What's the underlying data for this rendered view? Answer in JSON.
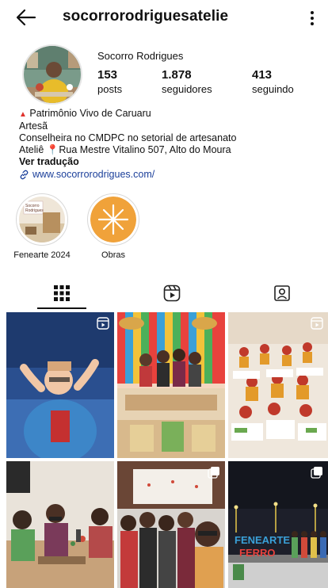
{
  "header": {
    "username": "socorrorodriguesatelie",
    "back_icon": "back-arrow-icon",
    "menu_icon": "more-vertical-icon"
  },
  "profile": {
    "display_name": "Socorro Rodrigues",
    "stats": [
      {
        "value": "153",
        "label": "posts"
      },
      {
        "value": "1.878",
        "label": "seguidores"
      },
      {
        "value": "413",
        "label": "seguindo"
      }
    ]
  },
  "bio": {
    "line1": "Patrimônio Vivo de Caruaru",
    "line2": "Artesã",
    "line3": "Conselheira no CMDPC no setorial de artesanato",
    "line4_prefix": "Ateliê",
    "line4_suffix": "Rua Mestre Vitalino 507, Alto do Moura",
    "translate": "Ver tradução",
    "link": "www.socorrorodrigues.com/"
  },
  "highlights": [
    {
      "label": "Fenearte 2024",
      "cover_text": "Socorro Rodrigues"
    },
    {
      "label": "Obras"
    }
  ],
  "tabs": [
    {
      "name": "grid-icon",
      "active": true
    },
    {
      "name": "reels-icon",
      "active": false
    },
    {
      "name": "tagged-icon",
      "active": false
    }
  ],
  "posts": [
    {
      "type": "reel"
    },
    {
      "type": "photo"
    },
    {
      "type": "reel"
    },
    {
      "type": "photo"
    },
    {
      "type": "carousel"
    },
    {
      "type": "carousel",
      "sign_text": "FENEARTE FERRO"
    }
  ],
  "colors": {
    "link": "#1b3f9a",
    "accent_red": "#e0322d",
    "obras_orange": "#f0a23a"
  }
}
